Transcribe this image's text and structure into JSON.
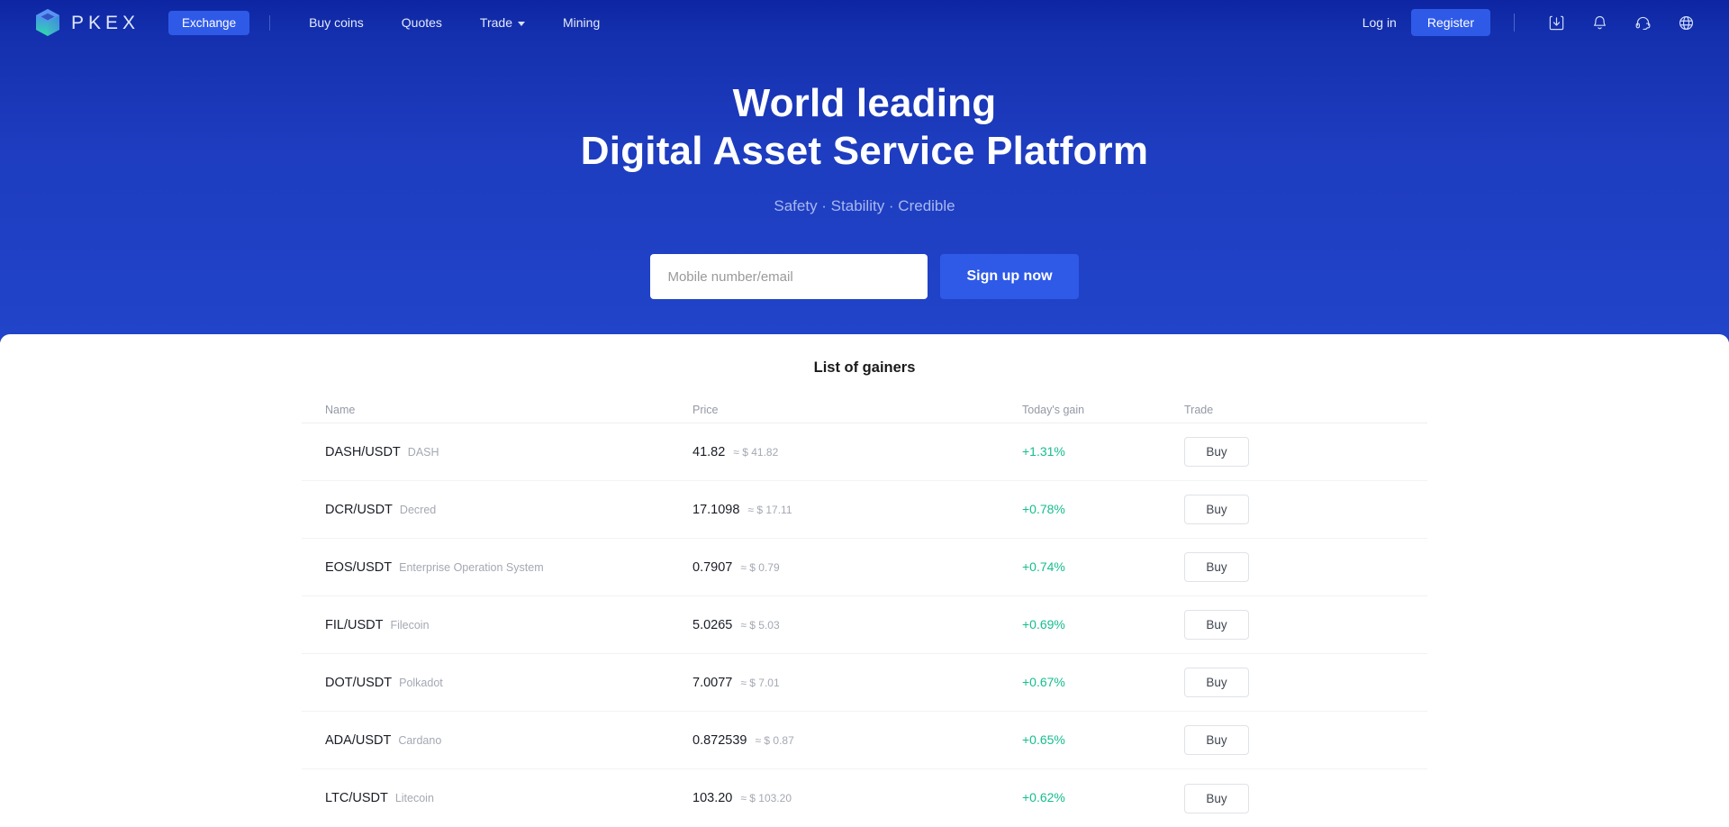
{
  "brand": {
    "name": "PKEX",
    "logo_icon": "cube-logo-icon"
  },
  "nav": {
    "active": {
      "label": "Exchange"
    },
    "items": [
      {
        "label": "Buy coins",
        "icon": null
      },
      {
        "label": "Quotes",
        "icon": null
      },
      {
        "label": "Trade",
        "icon": "chevron-down-icon"
      },
      {
        "label": "Mining",
        "icon": null
      }
    ]
  },
  "header_right": {
    "login_label": "Log in",
    "register_label": "Register",
    "icons": [
      {
        "name": "download-app-icon"
      },
      {
        "name": "notification-bell-icon"
      },
      {
        "name": "support-headset-icon"
      },
      {
        "name": "language-globe-icon"
      }
    ]
  },
  "hero": {
    "title_line1": "World leading",
    "title_line2": "Digital Asset Service Platform",
    "subtitle": "Safety · Stability · Credible"
  },
  "signup": {
    "placeholder": "Mobile number/email",
    "value": "",
    "button_label": "Sign up now"
  },
  "gainers": {
    "title": "List of gainers",
    "columns": [
      "Name",
      "Price",
      "Today's gain",
      "Trade"
    ],
    "buy_label": "Buy",
    "rows": [
      {
        "symbol": "DASH/USDT",
        "full_name": "DASH",
        "price": "41.82",
        "usd": "≈ $ 41.82",
        "gain": "+1.31%"
      },
      {
        "symbol": "DCR/USDT",
        "full_name": "Decred",
        "price": "17.1098",
        "usd": "≈ $ 17.11",
        "gain": "+0.78%"
      },
      {
        "symbol": "EOS/USDT",
        "full_name": "Enterprise Operation System",
        "price": "0.7907",
        "usd": "≈ $ 0.79",
        "gain": "+0.74%"
      },
      {
        "symbol": "FIL/USDT",
        "full_name": "Filecoin",
        "price": "5.0265",
        "usd": "≈ $ 5.03",
        "gain": "+0.69%"
      },
      {
        "symbol": "DOT/USDT",
        "full_name": "Polkadot",
        "price": "7.0077",
        "usd": "≈ $ 7.01",
        "gain": "+0.67%"
      },
      {
        "symbol": "ADA/USDT",
        "full_name": "Cardano",
        "price": "0.872539",
        "usd": "≈ $ 0.87",
        "gain": "+0.65%"
      },
      {
        "symbol": "LTC/USDT",
        "full_name": "Litecoin",
        "price": "103.20",
        "usd": "≈ $ 103.20",
        "gain": "+0.62%"
      }
    ]
  },
  "colors": {
    "header_blue": "#0d25a2",
    "hero_blue": "#2144c9",
    "accent_blue": "#2f5ae8",
    "gain_green": "#16bd8e",
    "panel_white": "#ffffff"
  }
}
